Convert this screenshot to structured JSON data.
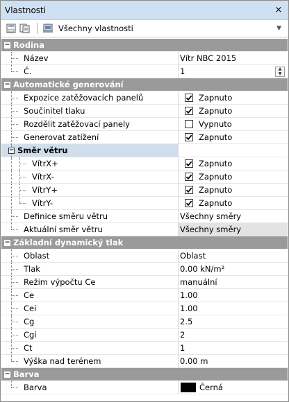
{
  "window": {
    "title": "Vlastnosti",
    "close": "×"
  },
  "toolbar": {
    "view": "Všechny vlastnosti"
  },
  "sections": [
    {
      "label": "Rodina",
      "rows": [
        {
          "name": "Název",
          "value": "Vítr NBC 2015",
          "type": "text"
        },
        {
          "name": "Č.",
          "value": "1",
          "type": "spin"
        }
      ]
    },
    {
      "label": "Automatické generování",
      "rows": [
        {
          "name": "Expozice zatěžovacích panelů",
          "value": "Zapnuto",
          "type": "check",
          "checked": true
        },
        {
          "name": "Součinitel tlaku",
          "value": "Zapnuto",
          "type": "check",
          "checked": true
        },
        {
          "name": "Rozdělit zatěžovací panely",
          "value": "Vypnuto",
          "type": "check",
          "checked": false
        },
        {
          "name": "Generovat zatížení",
          "value": "Zapnuto",
          "type": "check",
          "checked": true
        }
      ],
      "subgroup": {
        "label": "Směr větru",
        "rows": [
          {
            "name": "VítrX+",
            "value": "Zapnuto",
            "type": "check",
            "checked": true
          },
          {
            "name": "VítrX-",
            "value": "Zapnuto",
            "type": "check",
            "checked": true
          },
          {
            "name": "VítrY+",
            "value": "Zapnuto",
            "type": "check",
            "checked": true
          },
          {
            "name": "VítrY-",
            "value": "Zapnuto",
            "type": "check",
            "checked": true
          }
        ]
      },
      "after": [
        {
          "name": "Definice směru větru",
          "value": "Všechny směry",
          "type": "text"
        },
        {
          "name": "Aktuální směr větru",
          "value": "Všechny směry",
          "type": "readonly"
        }
      ]
    },
    {
      "label": "Základní dynamický tlak",
      "rows": [
        {
          "name": "Oblast",
          "value": "Oblast",
          "type": "text"
        },
        {
          "name": "Tlak",
          "value": "0.00 kN/m²",
          "type": "text"
        },
        {
          "name": "Režim výpočtu Ce",
          "value": "manuální",
          "type": "text"
        },
        {
          "name": "Ce",
          "value": "1.00",
          "type": "text"
        },
        {
          "name": "Cei",
          "value": "1.00",
          "type": "text"
        },
        {
          "name": "Cg",
          "value": "2.5",
          "type": "text"
        },
        {
          "name": "Cgi",
          "value": "2",
          "type": "text"
        },
        {
          "name": "Ct",
          "value": "1",
          "type": "text"
        },
        {
          "name": "Výška nad terénem",
          "value": "0.00 m",
          "type": "text"
        }
      ]
    },
    {
      "label": "Barva",
      "rows": [
        {
          "name": "Barva",
          "value": "Černá",
          "type": "color",
          "color": "#000000"
        }
      ]
    }
  ],
  "colors": {
    "titlebar": "#cfe0f2",
    "category": "#9a9a9a",
    "subgroup": "#cfdeea",
    "readonly": "#e3e3e3"
  }
}
